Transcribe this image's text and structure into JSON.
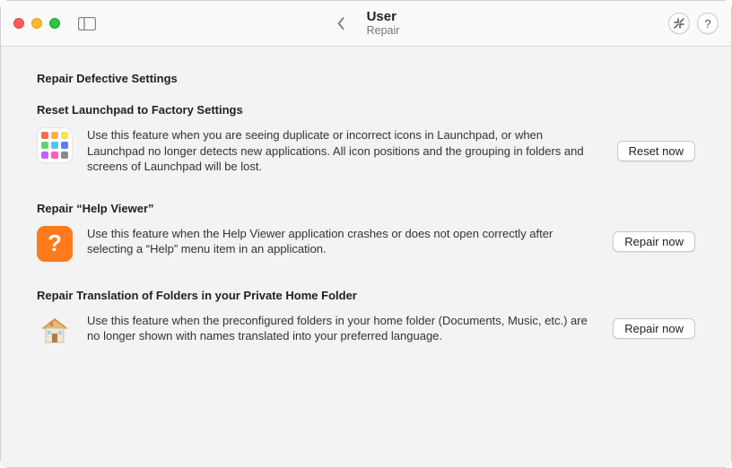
{
  "header": {
    "title": "User",
    "subtitle": "Repair"
  },
  "page": {
    "heading": "Repair Defective Settings"
  },
  "sections": {
    "launchpad": {
      "title": "Reset Launchpad to Factory Settings",
      "desc": "Use this feature when you are seeing duplicate or incorrect icons in Launchpad, or when Launchpad no longer detects new applications. All icon positions and the grouping in folders and screens of Launchpad will be lost.",
      "button": "Reset now"
    },
    "helpviewer": {
      "title": "Repair “Help Viewer”",
      "desc": "Use this feature when the Help Viewer application crashes or does not open correctly after selecting a “Help” menu item in an application.",
      "button": "Repair now"
    },
    "translation": {
      "title": "Repair Translation of Folders in your Private Home Folder",
      "desc": "Use this feature when the preconfigured folders in your home folder (Documents, Music, etc.) are no longer shown with names translated into your preferred language.",
      "button": "Repair now"
    }
  },
  "colors": {
    "lp": [
      "#ff6a4d",
      "#ffb340",
      "#ffe14d",
      "#62d46b",
      "#4dc6ff",
      "#5c7cff",
      "#c65cff",
      "#ff5cb3",
      "#8c8c8c"
    ],
    "helpBg": "#ff7a1a",
    "helpFg": "#ffffff"
  },
  "glyphs": {
    "help_question": "?",
    "titlebar_help": "?"
  }
}
